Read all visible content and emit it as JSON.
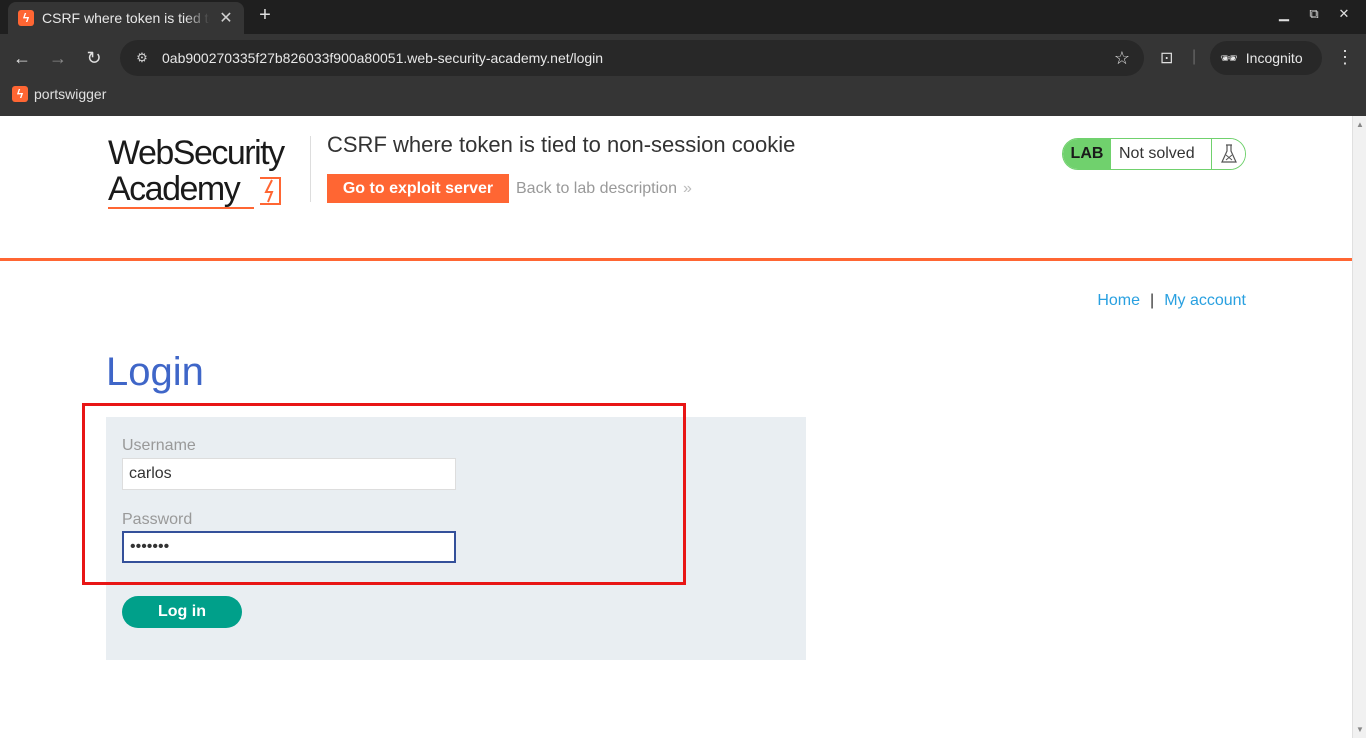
{
  "browser": {
    "tab_title": "CSRF where token is tied to non-session cookie",
    "tab_favicon": "portswigger-bolt-icon",
    "new_tab_label": "+",
    "url": "0ab900270335f27b826033f900a80051.web-security-academy.net/login",
    "incognito_label": "Incognito",
    "bookmark_label": "portswigger"
  },
  "header": {
    "logo_line1": "WebSecurity",
    "logo_line2": "Academy",
    "lab_title": "CSRF where token is tied to non-session cookie",
    "exploit_button": "Go to exploit server",
    "back_link": "Back to lab description",
    "back_chevron": "»",
    "lab_badge": "LAB",
    "lab_status": "Not solved",
    "brand_color": "#ff6633",
    "status_color": "#70d16d"
  },
  "nav": {
    "home": "Home",
    "separator": "|",
    "my_account": "My account"
  },
  "login": {
    "title": "Login",
    "username_label": "Username",
    "username_value": "carlos",
    "password_label": "Password",
    "password_value": "•••••••",
    "submit_label": "Log in"
  },
  "annotation": {
    "highlight_color": "#e81515"
  }
}
